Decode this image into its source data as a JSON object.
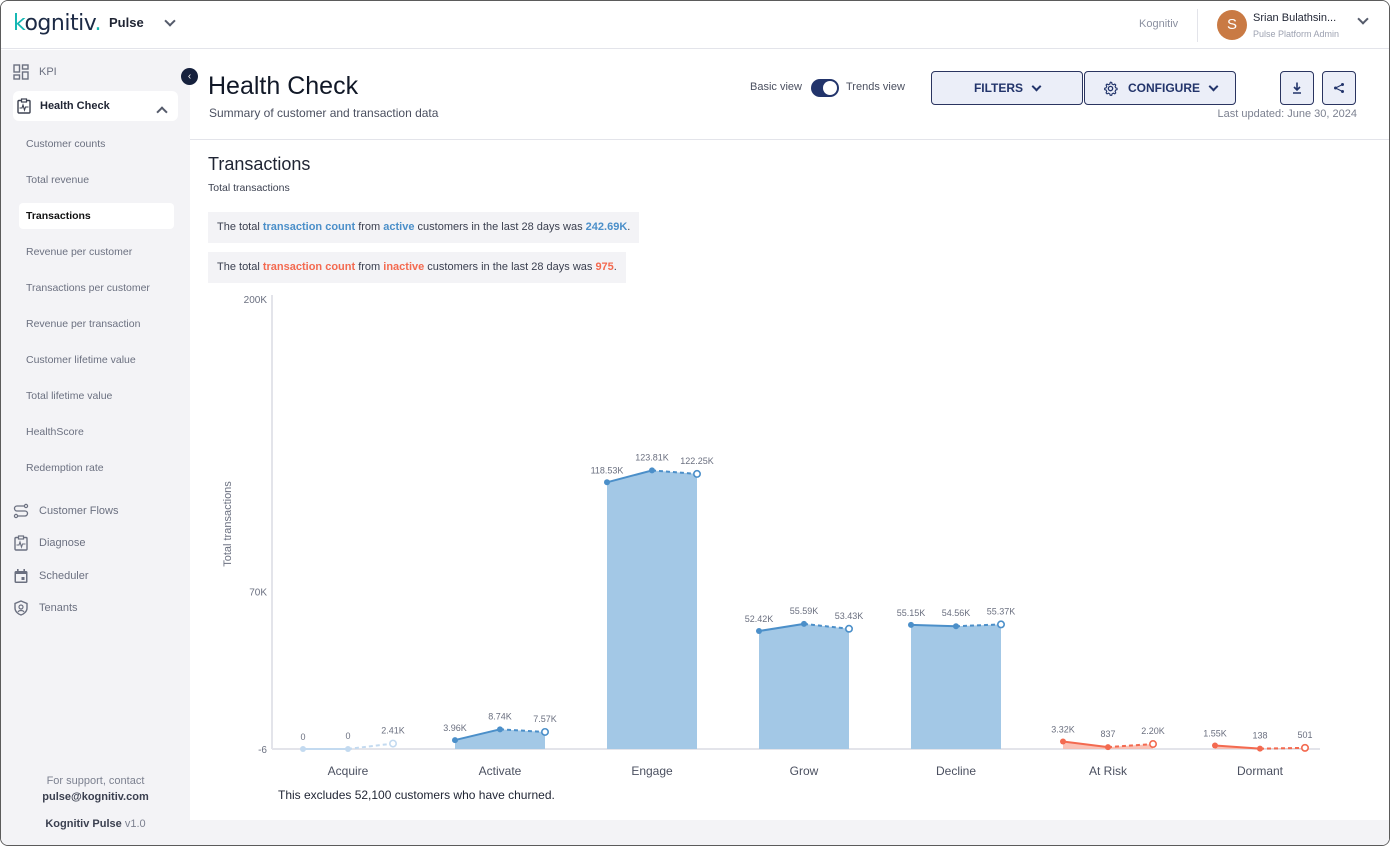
{
  "topbar": {
    "logo": "kognitiv",
    "app_name": "Pulse",
    "tenant": "Kognitiv",
    "user": {
      "initial": "S",
      "name": "Srian Bulathsin...",
      "role": "Pulse Platform Admin"
    }
  },
  "sidebar": {
    "kpi": "KPI",
    "health_check": "Health Check",
    "sub_items": [
      {
        "label": "Customer counts",
        "active": false
      },
      {
        "label": "Total revenue",
        "active": false
      },
      {
        "label": "Transactions",
        "active": true
      },
      {
        "label": "Revenue per customer",
        "active": false
      },
      {
        "label": "Transactions per customer",
        "active": false
      },
      {
        "label": "Revenue per transaction",
        "active": false
      },
      {
        "label": "Customer lifetime value",
        "active": false
      },
      {
        "label": "Total lifetime value",
        "active": false
      },
      {
        "label": "HealthScore",
        "active": false
      },
      {
        "label": "Redemption rate",
        "active": false
      }
    ],
    "other_items": [
      "Customer Flows",
      "Diagnose",
      "Scheduler",
      "Tenants"
    ],
    "support_line": "For support, contact",
    "support_email": "pulse@kognitiv.com",
    "product": "Kognitiv Pulse",
    "version": "v1.0"
  },
  "header": {
    "title": "Health Check",
    "subtitle": "Summary of customer and transaction data",
    "basic_view": "Basic view",
    "trends_view": "Trends view",
    "filters": "FILTERS",
    "configure": "CONFIGURE",
    "last_updated": "Last updated: June 30, 2024"
  },
  "section": {
    "title": "Transactions",
    "subtitle": "Total transactions",
    "active_callout": {
      "pre": "The total ",
      "metric": "transaction count",
      "mid": " from ",
      "segment": "active",
      "post": " customers in the last 28 days was ",
      "value": "242.69K",
      "end": "."
    },
    "inactive_callout": {
      "pre": "The total ",
      "metric": "transaction count",
      "mid": " from ",
      "segment": "inactive",
      "post": " customers in the last 28 days was ",
      "value": "975",
      "end": "."
    },
    "footnote": "This excludes 52,100 customers who have churned."
  },
  "colors": {
    "active_blue": "#4b8fc9",
    "bar_blue": "#a3c8e6",
    "inactive_red": "#f36a50",
    "inactive_fill": "#f9b3a4",
    "acquire_light": "#c3daf0",
    "brand_navy": "#22346b"
  },
  "chart_data": {
    "type": "bar",
    "title": "Transactions",
    "ylabel": "Total transactions",
    "xlabel": "",
    "ylim": [
      -6,
      200000
    ],
    "y_ticks": [
      "200K",
      "70K",
      "-6"
    ],
    "y_tick_values": [
      200000,
      70000,
      -6
    ],
    "categories": [
      "Acquire",
      "Activate",
      "Engage",
      "Grow",
      "Decline",
      "At Risk",
      "Dormant"
    ],
    "series": [
      {
        "name": "trend",
        "points_per_category": 3,
        "values": [
          [
            0,
            0,
            2410
          ],
          [
            3960,
            8740,
            7570
          ],
          [
            118530,
            123810,
            122250
          ],
          [
            52420,
            55590,
            53430
          ],
          [
            55150,
            54560,
            55370
          ],
          [
            3320,
            837,
            2200
          ],
          [
            1550,
            138,
            501
          ]
        ],
        "labels": [
          [
            "0",
            "0",
            "2.41K"
          ],
          [
            "3.96K",
            "8.74K",
            "7.57K"
          ],
          [
            "118.53K",
            "123.81K",
            "122.25K"
          ],
          [
            "52.42K",
            "55.59K",
            "53.43K"
          ],
          [
            "55.15K",
            "54.56K",
            "55.37K"
          ],
          [
            "3.32K",
            "837",
            "2.20K"
          ],
          [
            "1.55K",
            "138",
            "501"
          ]
        ],
        "status": [
          "acquire",
          "active",
          "active",
          "active",
          "active",
          "inactive",
          "inactive"
        ],
        "last_point_projected": true
      }
    ],
    "grid": false,
    "legend": "none"
  }
}
